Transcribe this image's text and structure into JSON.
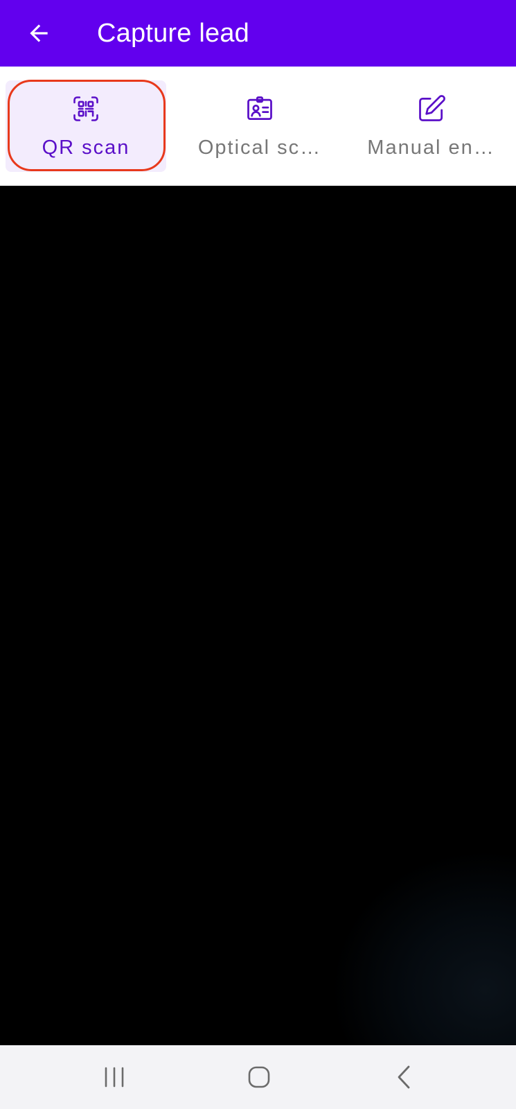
{
  "colors": {
    "app_bar": "#6200ee",
    "active_tab_bg": "#f3ecfd",
    "active_text": "#5a0fc8",
    "inactive_text": "#777777",
    "highlight_ring": "#e8391c",
    "nav_bg": "#f3f3f6",
    "nav_icon": "#6b6b6b"
  },
  "header": {
    "back_icon": "arrow-left-icon",
    "title": "Capture lead"
  },
  "tabs": [
    {
      "label": "QR scan",
      "icon": "qr-code-icon",
      "active": true
    },
    {
      "label": "Optical sc…",
      "icon": "id-card-icon",
      "active": false
    },
    {
      "label": "Manual en…",
      "icon": "edit-icon",
      "active": false
    }
  ],
  "system_nav": {
    "recents_icon": "recents-icon",
    "home_icon": "home-icon",
    "back_icon": "chevron-left-icon"
  }
}
